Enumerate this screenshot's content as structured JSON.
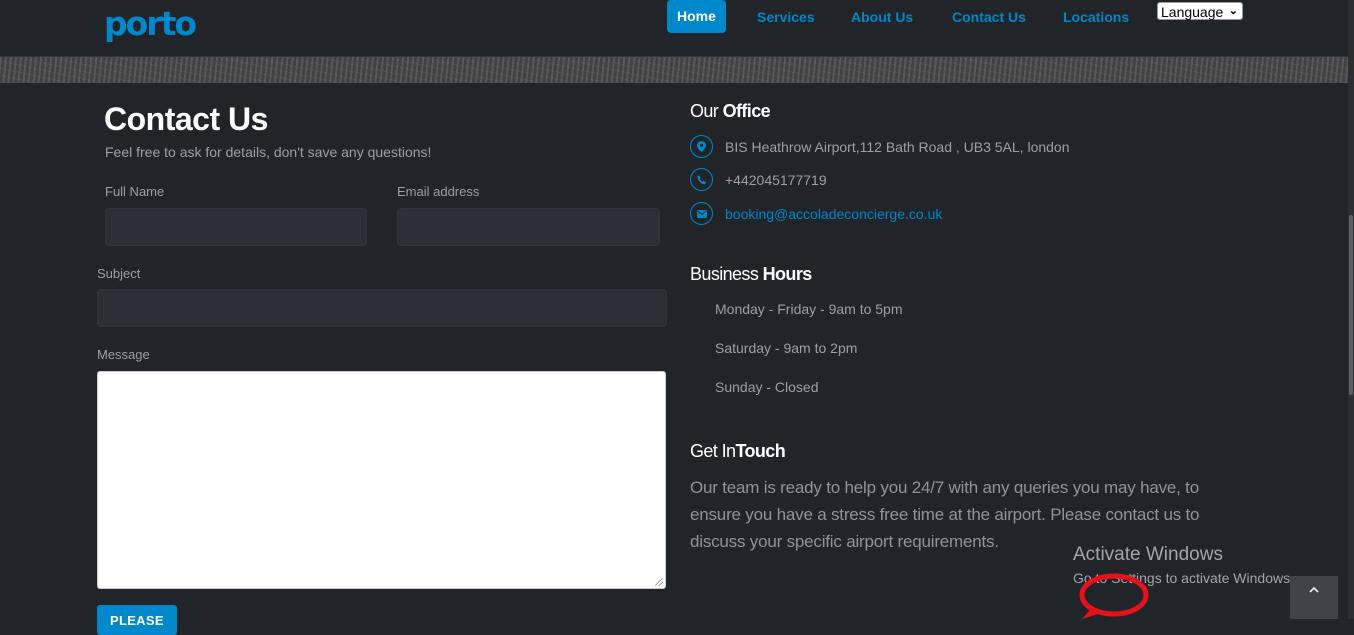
{
  "header": {
    "logo": "porto",
    "nav": [
      "Home",
      "Services",
      "About Us",
      "Contact Us",
      "Locations"
    ],
    "language_select": "Language"
  },
  "form": {
    "title": "Contact Us",
    "subtitle": "Feel free to ask for details, don't save any questions!",
    "full_name_label": "Full Name",
    "email_label": "Email address",
    "subject_label": "Subject",
    "message_label": "Message",
    "submit_label": "PLEASE"
  },
  "office": {
    "heading_light": "Our ",
    "heading_bold": "Office",
    "address": "BIS Heathrow Airport,112 Bath Road , UB3 5AL, london",
    "phone": "+442045177719",
    "email": "booking@accoladeconcierge.co.uk"
  },
  "hours": {
    "heading_light": "Business ",
    "heading_bold": "Hours",
    "items": [
      "Monday - Friday - 9am to 5pm",
      "Saturday - 9am to 2pm",
      "Sunday - Closed"
    ]
  },
  "touch": {
    "heading_light": "Get In",
    "heading_bold": "Touch",
    "text": "Our team is ready to help you 24/7 with any queries you may have, to ensure you have a stress free time at the airport. Please contact us to discuss your specific airport requirements."
  },
  "watermark": {
    "line1": "Activate Windows",
    "line2": "Go to Settings to activate Windows."
  },
  "icons": {
    "address": "map-marker-icon",
    "phone": "phone-icon",
    "email": "envelope-icon",
    "chat": "chat-bubble-icon",
    "scroll_top": "chevron-up-icon"
  },
  "colors": {
    "accent": "#0088cc",
    "background": "#212529",
    "chat": "#e8101b"
  }
}
